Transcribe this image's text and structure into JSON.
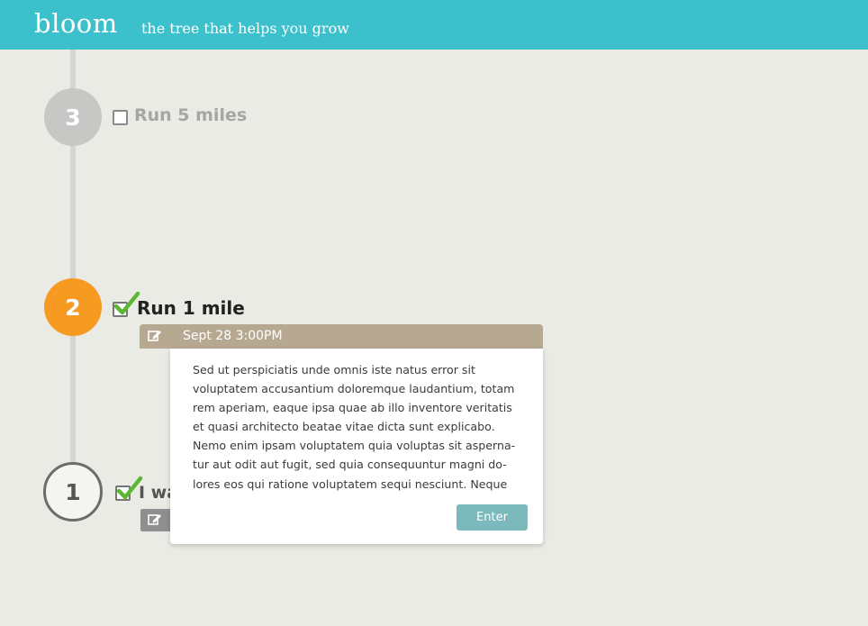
{
  "header": {
    "logo": "bloom",
    "tagline": "the tree that helps you grow",
    "color": "#3cc0cc"
  },
  "timeline": {
    "nodes": [
      {
        "number": "3",
        "task": "Run 5 miles",
        "checked": false,
        "status": "upcoming",
        "color": "#c7c7c5"
      },
      {
        "number": "2",
        "task": "Run 1 mile",
        "checked": true,
        "status": "current",
        "color": "#f79a22"
      },
      {
        "number": "1",
        "task": "I wa",
        "checked": true,
        "status": "completed",
        "color": "#6c6c6c"
      }
    ]
  },
  "popup": {
    "icon": "edit-icon",
    "date": "Sept 28 3:00PM",
    "lines": [
      "Sed ut perspiciatis unde omnis iste natus error sit",
      "voluptatem accusantium doloremque laudantium, totam",
      "rem aperiam, eaque ipsa quae ab illo inventore veritatis",
      "et quasi architecto beatae vitae dicta sunt explicabo.",
      "Nemo enim ipsam voluptatem quia voluptas sit asperna-",
      "tur aut odit aut fugit, sed quia consequuntur magni do-",
      "lores eos qui ratione voluptatem sequi nesciunt. Neque"
    ],
    "enter_label": "Enter",
    "header_color": "#b7a892",
    "button_color": "#7bb9bd"
  },
  "icons": {
    "check": "checkmark-icon",
    "edit": "edit-icon"
  }
}
